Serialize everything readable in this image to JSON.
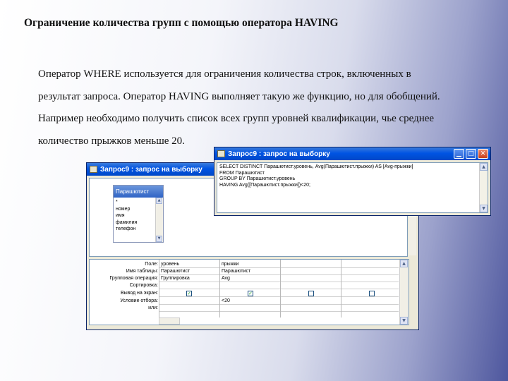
{
  "slide": {
    "title": "Ограничение количества групп с помощью оператора HAVING",
    "lines": [
      "Оператор WHERE используется для ограничения количества строк, включенных в",
      "результат запроса. Оператор HAVING выполняет такую же функцию, но для обобщений.",
      "Например необходимо получить список всех групп уровней квалификации, чье среднее",
      "количество прыжков меньше 20."
    ]
  },
  "sql_window": {
    "title": "Запрос9 : запрос на выборку",
    "buttons": {
      "minimize": "▁",
      "maximize": "□",
      "close": "✕"
    },
    "lines": [
      "SELECT DISTINCT Парашютист.уровень, Avg(Парашютист.прыжки) AS [Avg-прыжки]",
      "FROM Парашютист",
      "GROUP BY Парашютист.уровень",
      "HAVING Avg([Парашютист.прыжки])<20;"
    ]
  },
  "design_window": {
    "title": "Запрос9 : запрос на выборку",
    "table": {
      "name": "Парашютист",
      "fields": [
        "*",
        "номер",
        "имя",
        "фамилия",
        "телефон"
      ]
    },
    "grid": {
      "row_labels": [
        "Поле:",
        "Имя таблицы:",
        "Групповая операция:",
        "Сортировка:",
        "Вывод на экран:",
        "Условие отбора:",
        "или:"
      ],
      "columns": [
        {
          "field": "уровень",
          "table": "Парашютист",
          "group": "Группировка",
          "sort": "",
          "show": true,
          "criteria": "",
          "or": ""
        },
        {
          "field": "прыжки",
          "table": "Парашютист",
          "group": "Avg",
          "sort": "",
          "show": true,
          "criteria": "<20",
          "or": ""
        },
        {
          "field": "",
          "table": "",
          "group": "",
          "sort": "",
          "show": false,
          "criteria": "",
          "or": ""
        },
        {
          "field": "",
          "table": "",
          "group": "",
          "sort": "",
          "show": false,
          "criteria": "",
          "or": ""
        }
      ]
    }
  },
  "icons": {
    "check": "✓",
    "arrow_up": "▲",
    "arrow_down": "▼",
    "arrow_left": "◀"
  },
  "colors": {
    "titlebar": "#0054e3",
    "window_bg": "#ece9d8",
    "check": "#21a121"
  }
}
